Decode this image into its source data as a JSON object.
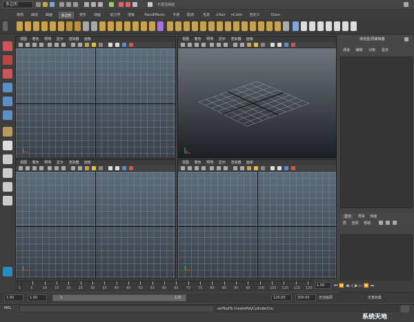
{
  "status_line": {
    "menu_set": "多边形",
    "status_text": "无激活曲面"
  },
  "shelf_tabs": [
    "常规",
    "曲线",
    "曲面",
    "多边形",
    "变形",
    "动画",
    "动力学",
    "渲染",
    "PaintEffects",
    "卡通",
    "肌肉",
    "毛发",
    "nHair",
    "nCloth",
    "自定义",
    "XGen"
  ],
  "shelf_active_index": 3,
  "viewports": [
    {
      "name": "top-left",
      "menu": [
        "视图",
        "着色",
        "照明",
        "显示",
        "渲染器",
        "面板"
      ]
    },
    {
      "name": "persp",
      "menu": [
        "视图",
        "着色",
        "照明",
        "显示",
        "渲染器",
        "面板"
      ]
    },
    {
      "name": "bottom-left",
      "menu": [
        "视图",
        "着色",
        "照明",
        "显示",
        "渲染器",
        "面板"
      ]
    },
    {
      "name": "bottom-right",
      "menu": [
        "视图",
        "着色",
        "照明",
        "显示",
        "渲染器",
        "面板"
      ]
    }
  ],
  "channel_box": {
    "title": "通道盒/层编辑器",
    "menu": [
      "通道",
      "编辑",
      "对象",
      "显示"
    ]
  },
  "layer_editor": {
    "tabs": [
      "显示",
      "渲染",
      "动画"
    ],
    "menu": [
      "层",
      "选项",
      "帮助"
    ]
  },
  "timeline": {
    "ticks": [
      "1",
      "5",
      "10",
      "15",
      "20",
      "25",
      "30",
      "35",
      "40",
      "45",
      "50",
      "55",
      "60",
      "65",
      "70",
      "75",
      "80",
      "85",
      "90",
      "95",
      "100",
      "105",
      "110",
      "115",
      "120"
    ],
    "current_frame": "1.00"
  },
  "range_slider": {
    "start": "1.00",
    "inner_start": "1.00",
    "slider_start": "1",
    "slider_end": "120",
    "end": "120.00",
    "total_end": "200.00",
    "anim_layer": "无动画层",
    "char_set": "无角色集"
  },
  "command_line": {
    "label": "MEL",
    "feedback": "setToolTo CreatePolyCylinderCtx;"
  },
  "watermark": "系统天地"
}
